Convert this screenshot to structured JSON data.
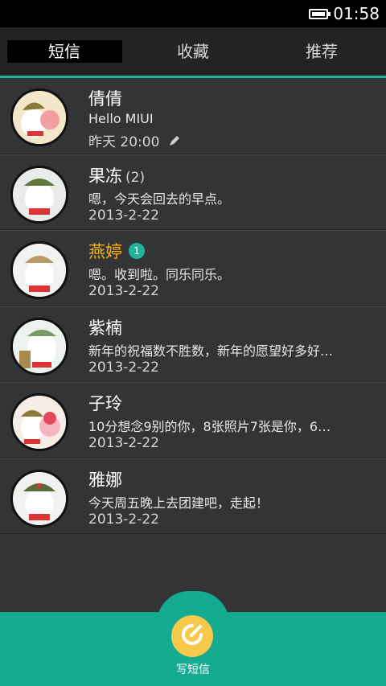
{
  "status_bar": {
    "time": "01:58"
  },
  "tabs": [
    {
      "label": "短信",
      "active": true
    },
    {
      "label": "收藏",
      "active": false
    },
    {
      "label": "推荐",
      "active": false
    }
  ],
  "conversations": [
    {
      "name": "倩倩",
      "count": "",
      "badge": "",
      "unread": false,
      "preview": "Hello MIUI",
      "date": "昨天 20:00",
      "draft": true
    },
    {
      "name": "果冻",
      "count": "(2)",
      "badge": "",
      "unread": false,
      "preview": "嗯，今天会回去的早点。",
      "date": "2013-2-22",
      "draft": false
    },
    {
      "name": "燕婷",
      "count": "",
      "badge": "1",
      "unread": true,
      "preview": "嗯。收到啦。同乐同乐。",
      "date": "2013-2-22",
      "draft": false
    },
    {
      "name": "紫楠",
      "count": "",
      "badge": "",
      "unread": false,
      "preview": "新年的祝福数不胜数，新年的愿望好多好…",
      "date": "2013-2-22",
      "draft": false
    },
    {
      "name": "子玲",
      "count": "",
      "badge": "",
      "unread": false,
      "preview": "10分想念9别的你，8张照片7张是你，6…",
      "date": "2013-2-22",
      "draft": false
    },
    {
      "name": "雅娜",
      "count": "",
      "badge": "",
      "unread": false,
      "preview": "今天周五晚上去团建吧，走起！",
      "date": "2013-2-22",
      "draft": false
    }
  ],
  "compose": {
    "label": "写短信"
  },
  "colors": {
    "accent": "#14ab91",
    "unread_name": "#f7b216",
    "compose_button": "#f7c94a"
  }
}
